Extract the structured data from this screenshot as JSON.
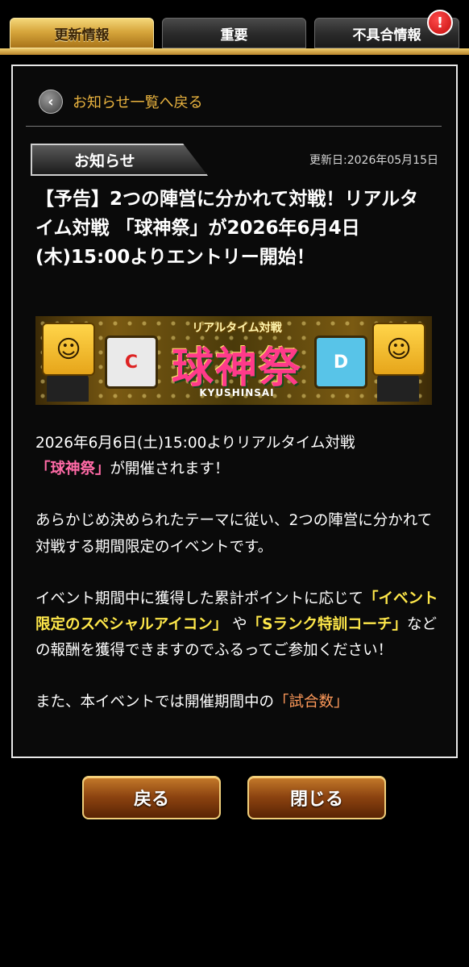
{
  "tabs": [
    {
      "label": "更新情報",
      "active": true
    },
    {
      "label": "重要",
      "active": false
    },
    {
      "label": "不具合情報",
      "active": false,
      "badge": "!"
    }
  ],
  "back_link": {
    "icon": "chevron-left-icon",
    "label": "お知らせ一覧へ戻る"
  },
  "notice": {
    "tag": "お知らせ",
    "updated": "更新日:2026年05月15日",
    "headline": "【予告】2つの陣営に分かれて対戦！リアルタイム対戦 「球神祭」が2026年6月4日(木)15:00よりエントリー開始！"
  },
  "banner": {
    "subtitle": "リアルタイム対戦",
    "logo": "球神祭",
    "romaji": "KYUSHINSAI"
  },
  "body": {
    "p1_a": "2026年6月6日(土)15:00よりリアルタイム対戦",
    "p1_hl": "「球神祭」",
    "p1_b": "が開催されます！",
    "p2": "あらかじめ決められたテーマに従い、2つの陣営に分かれて対戦する期間限定のイベントです。",
    "p3_a": "イベント期間中に獲得した累計ポイントに応じて",
    "p3_hl1": "「イベント限定のスペシャルアイコン」",
    "p3_b": " や",
    "p3_hl2": "「Sランク特訓コーチ」",
    "p3_c": "などの報酬を獲得できますのでふるってご参加ください！",
    "p4_a": "また、本イベントでは開催期間中の",
    "p4_hl": "「試合数」"
  },
  "buttons": {
    "back": "戻る",
    "close": "閉じる"
  },
  "colors": {
    "accent_gold": "#e9b33f",
    "highlight_pink": "#ff6aa6",
    "highlight_yellow": "#ffe84a",
    "highlight_orange": "#ff9a5a"
  }
}
